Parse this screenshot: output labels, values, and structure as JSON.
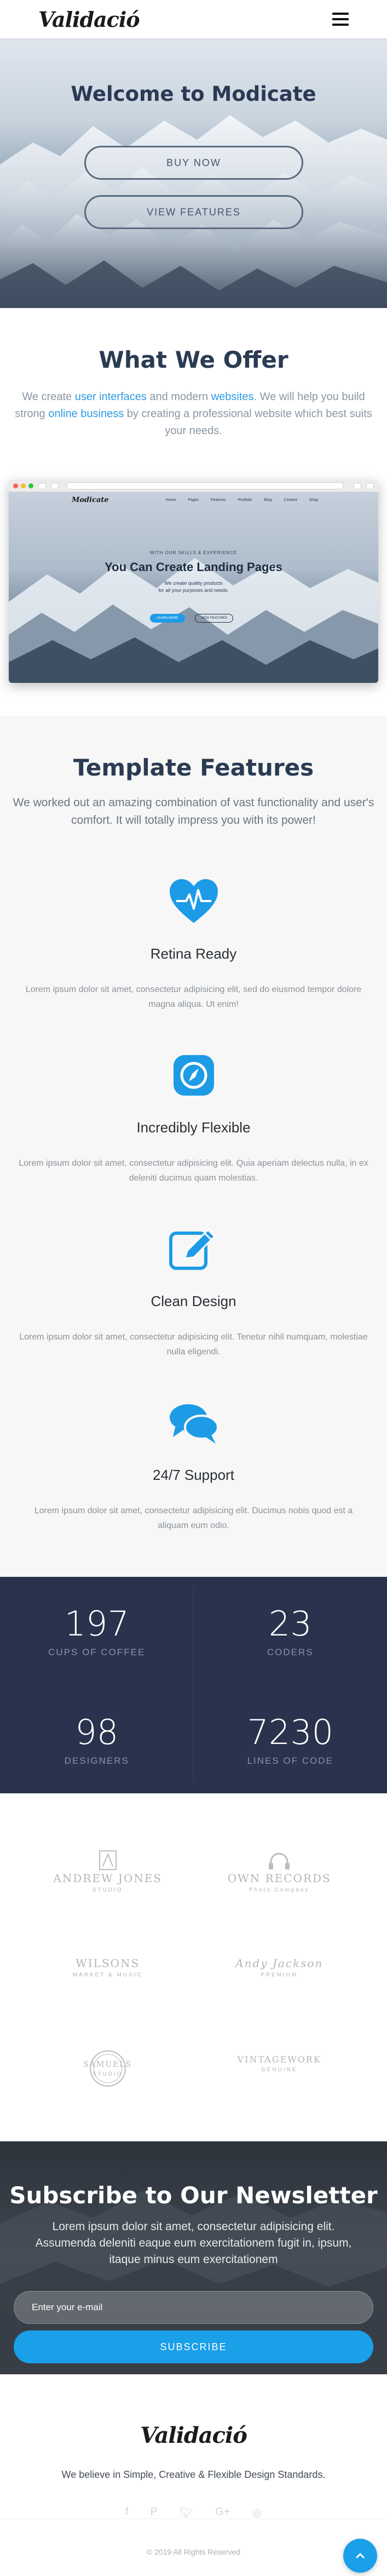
{
  "navbar": {
    "logo": "Validació",
    "menu_icon": "hamburger-menu-icon"
  },
  "hero": {
    "title": "Welcome to Modicate",
    "buy_button": "BUY NOW",
    "features_button": "VIEW FEATURES"
  },
  "offer": {
    "title": "What We Offer",
    "text_part1": "We create ",
    "link1": "user interfaces",
    "text_part2": " and modern ",
    "link2": "websites",
    "text_part3": ". We will help you build strong ",
    "link3": "online business",
    "text_part4": " by creating a professional website which best suits your needs.",
    "preview": {
      "logo": "Modicate",
      "nav_links": [
        "Home",
        "Pages",
        "Features",
        "Portfolio",
        "Blog",
        "Contact",
        "Shop"
      ],
      "subtitle": "WITH OUR SKILLS & EXPERIENCE",
      "title": "You Can Create Landing Pages",
      "desc_line1": "We create quality products",
      "desc_line2": "for all your purposes and needs.",
      "btn1": "LEARN MORE",
      "btn2": "VIEW FEATURES"
    }
  },
  "features": {
    "title": "Template Features",
    "subtitle": "We worked out an amazing combination of vast functionality and user's comfort. It will totally impress you with its power!",
    "items": [
      {
        "icon": "heart-pulse-icon",
        "title": "Retina Ready",
        "text": "Lorem ipsum dolor sit amet, consectetur adipisicing elit, sed do eiusmod tempor dolore magna aliqua. Ut enim!"
      },
      {
        "icon": "compass-icon",
        "title": "Incredibly Flexible",
        "text": "Lorem ipsum dolor sit amet, consectetur adipisicing elit. Quia aperiam delectus nulla, in ex deleniti ducimus quam molestias."
      },
      {
        "icon": "edit-icon",
        "title": "Clean Design",
        "text": "Lorem ipsum dolor sit amet, consectetur adipisicing elit. Tenetur nihil numquam, molestiae nulla eligendi."
      },
      {
        "icon": "chat-bubbles-icon",
        "title": "24/7 Support",
        "text": "Lorem ipsum dolor sit amet, consectetur adipisicing elit. Ducimus nobis quod est a aliquam eum odio."
      }
    ]
  },
  "stats": [
    {
      "value": "197",
      "label": "CUPS OF COFFEE"
    },
    {
      "value": "23",
      "label": "CODERS"
    },
    {
      "value": "98",
      "label": "DESIGNERS"
    },
    {
      "value": "7230",
      "label": "LINES OF CODE"
    }
  ],
  "clients": [
    {
      "main": "ANDREW JONES",
      "sub": "STUDIO"
    },
    {
      "main": "OWN RECORDS",
      "sub": "Photo Company"
    },
    {
      "main": "WILSONS",
      "sub": "MARKET & MUSIC"
    },
    {
      "main": "Andy Jackson",
      "sub": "PREMIUM"
    },
    {
      "main": "SAMUELS",
      "sub": "STUDIO"
    },
    {
      "main": "VINTAGEWORK",
      "sub": "GENUINE"
    }
  ],
  "newsletter": {
    "title": "Subscribe to Our Newsletter",
    "text": "Lorem ipsum dolor sit amet, consectetur adipisicing elit. Assumenda deleniti eaque eum exercitationem fugit in, ipsum, itaque minus eum exercitationem",
    "input_placeholder": "Enter your e-mail",
    "button": "SUBSCRIBE"
  },
  "footer": {
    "logo": "Validació",
    "tagline": "We believe in Simple, Creative & Flexible Design Standards.",
    "socials": [
      "facebook-icon",
      "pinterest-icon",
      "twitter-icon",
      "google-plus-icon",
      "instagram-icon"
    ],
    "copyright": "© 2019 All Rights Reserved"
  },
  "colors": {
    "accent": "#1a9fe9",
    "dark_navy": "#2a334d",
    "heading": "#2a3b52"
  }
}
